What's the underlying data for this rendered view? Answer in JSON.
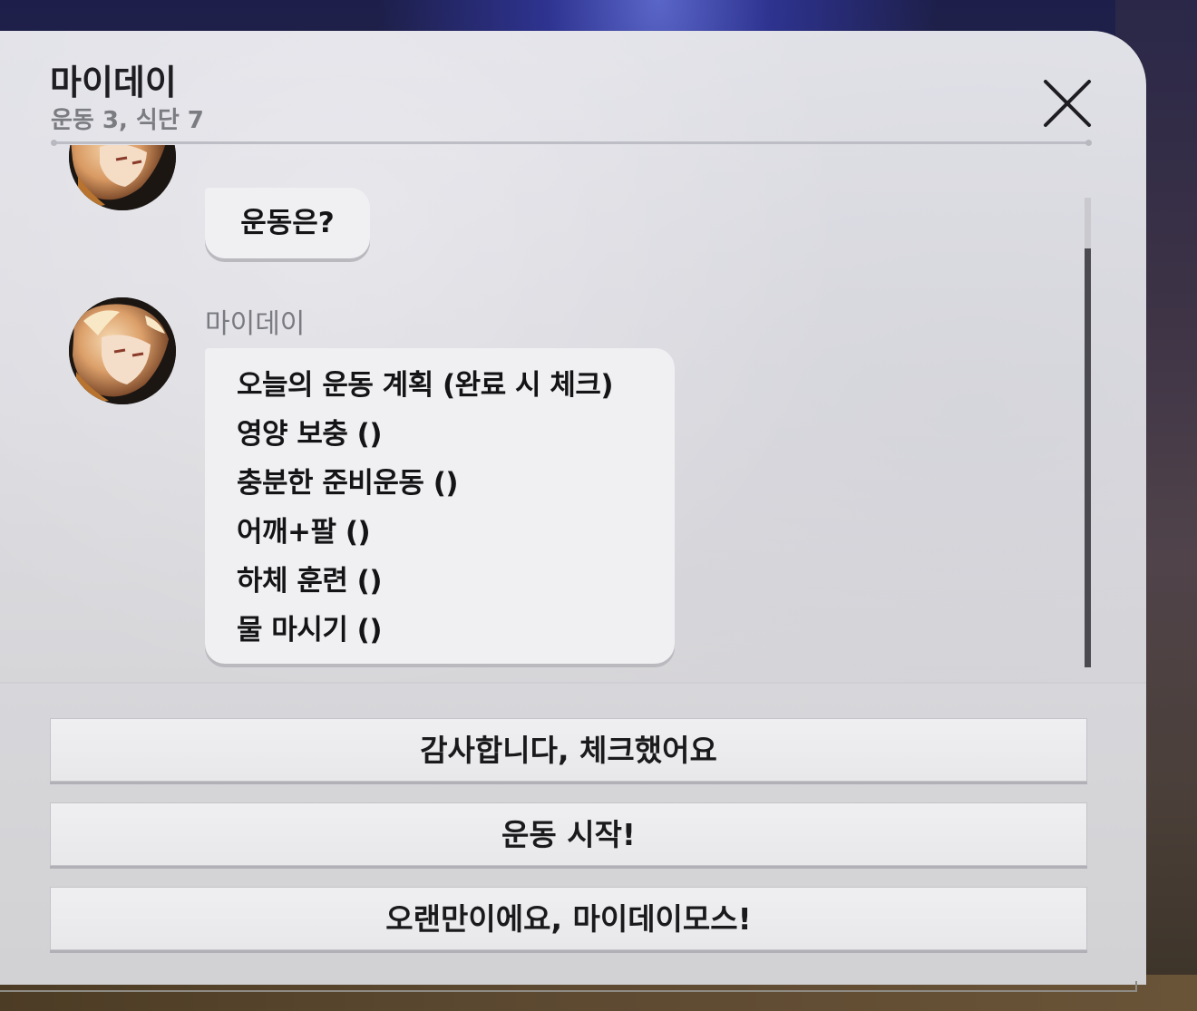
{
  "header": {
    "title": "마이데이",
    "subtitle": "운동 3, 식단 7"
  },
  "icons": {
    "close": "close-icon",
    "avatar": "character-avatar"
  },
  "chat": {
    "messages": [
      {
        "sender": "",
        "text": "운동은?"
      },
      {
        "sender": "마이데이",
        "lines": [
          "오늘의 운동 계획 (완료 시 체크)",
          "영양 보충 ()",
          "충분한 준비운동 ()",
          "어깨+팔 ()",
          "하체 훈련 ()",
          "물 마시기 ()"
        ]
      }
    ]
  },
  "options": [
    "감사합니다, 체크했어요",
    "운동 시작!",
    "오랜만이에요, 마이데이모스!"
  ],
  "colors": {
    "panel": "#dcdce1",
    "bubble": "#f0f0f2",
    "text": "#141416",
    "subtext": "#7b7b82",
    "scroll_thumb": "#4a4a50"
  }
}
